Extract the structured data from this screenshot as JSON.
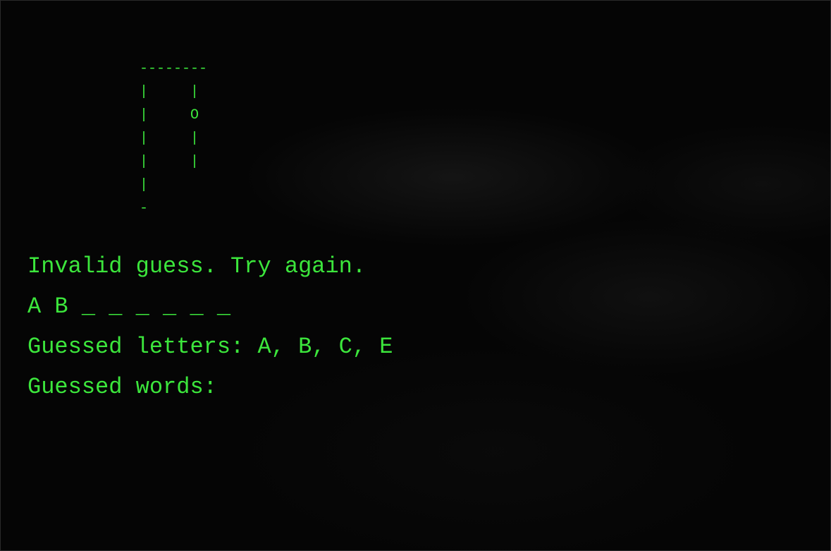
{
  "gallows_art": "--------\n|     |\n|     O\n|     |\n|     |\n|\n-",
  "message": "Invalid guess. Try again.",
  "word_display": "A B _ _ _ _ _ _",
  "guessed_letters": {
    "label": "Guessed letters:",
    "value": "A, B, C, E"
  },
  "guessed_words": {
    "label": "Guessed words:",
    "value": ""
  },
  "colors": {
    "text": "#3ce63c",
    "background": "#050505"
  }
}
